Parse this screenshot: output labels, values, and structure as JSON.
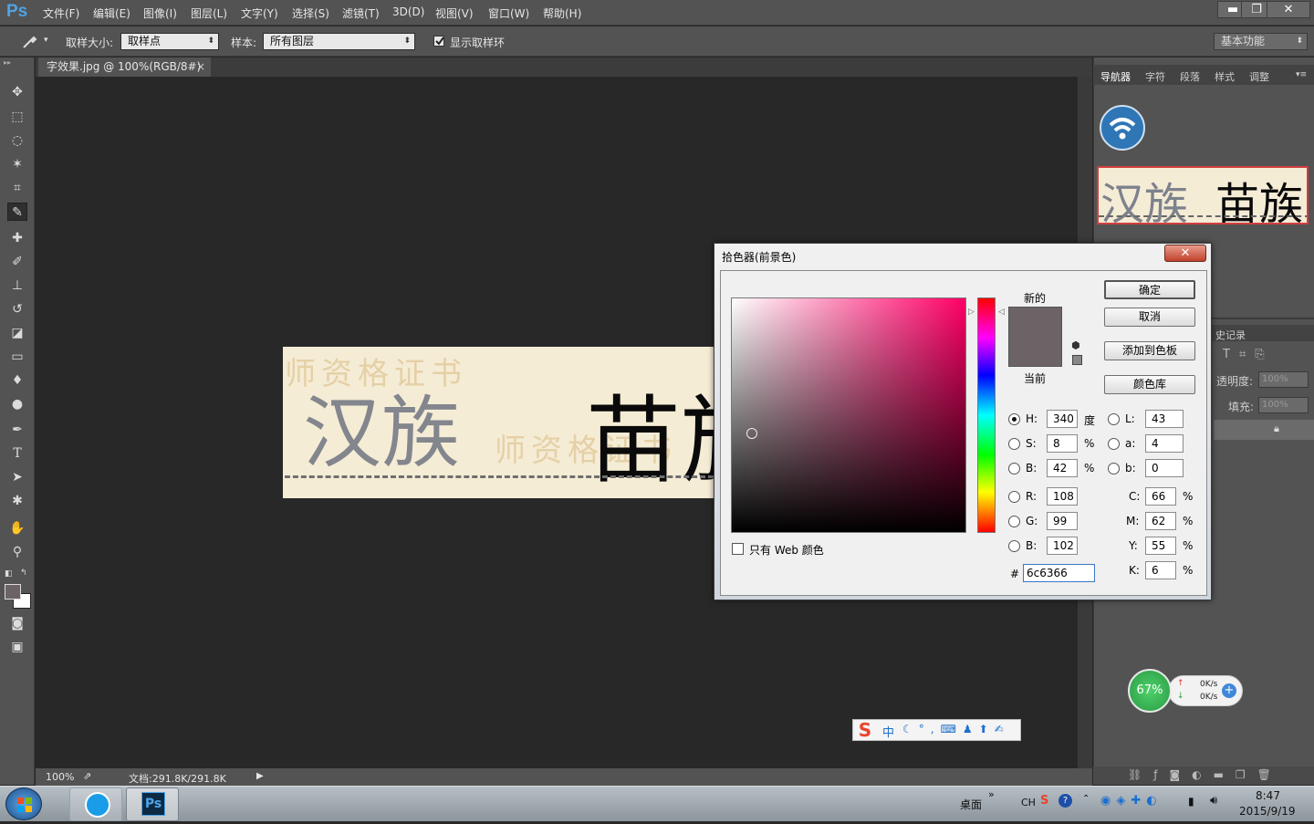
{
  "app": {
    "logo": "Ps"
  },
  "menu": [
    "文件(F)",
    "编辑(E)",
    "图像(I)",
    "图层(L)",
    "文字(Y)",
    "选择(S)",
    "滤镜(T)",
    "3D(D)",
    "视图(V)",
    "窗口(W)",
    "帮助(H)"
  ],
  "window_controls": {
    "minimize": "▬",
    "restore": "❐",
    "close": "✕"
  },
  "options": {
    "sample_size_label": "取样大小:",
    "sample_size_value": "取样点",
    "sample_label": "样本:",
    "sample_value": "所有图层",
    "show_ring_label": "显示取样环",
    "workspace": "基本功能"
  },
  "document": {
    "tab": "字效果.jpg @ 100%(RGB/8#)",
    "tab_close": "×",
    "zoom": "100%",
    "doc_size": "文档:291.8K/291.8K"
  },
  "image": {
    "text_left": "汉族",
    "text_right": "苗族",
    "watermark": "师资格证书"
  },
  "panel_tabs": [
    "导航器",
    "字符",
    "段落",
    "样式",
    "调整"
  ],
  "layers_panel": {
    "history_tab": "史记录",
    "opacity_label": "透明度:",
    "opacity_value": "100%",
    "fill_label": "填充:",
    "fill_value": "100%"
  },
  "color_picker": {
    "title": "拾色器(前景色)",
    "close": "✕",
    "new_label": "新的",
    "current_label": "当前",
    "buttons": {
      "ok": "确定",
      "cancel": "取消",
      "add_swatch": "添加到色板",
      "libraries": "颜色库"
    },
    "web_only_label": "只有 Web 颜色",
    "hsb": {
      "h_label": "H:",
      "h": "340",
      "h_unit": "度",
      "s_label": "S:",
      "s": "8",
      "s_unit": "%",
      "b_label": "B:",
      "b": "42",
      "b_unit": "%"
    },
    "rgb": {
      "r_label": "R:",
      "r": "108",
      "g_label": "G:",
      "g": "99",
      "b_label": "B:",
      "b": "102"
    },
    "lab": {
      "l_label": "L:",
      "l": "43",
      "a_label": "a:",
      "a": "4",
      "b_label": "b:",
      "b": "0"
    },
    "cmyk": {
      "c_label": "C:",
      "c": "66",
      "m_label": "M:",
      "m": "62",
      "y_label": "Y:",
      "y": "55",
      "k_label": "K:",
      "k": "6",
      "unit": "%"
    },
    "hex_label": "#",
    "hex": "6c6366",
    "new_color": "#6c6366",
    "hue_color": "#ff0066"
  },
  "net_widget": {
    "percent": "67%",
    "up": "0K/s",
    "down": "0K/s"
  },
  "ime": {
    "mode": "中"
  },
  "taskbar": {
    "desktop": "桌面",
    "lang": "CH",
    "time": "8:47",
    "date": "2015/9/19"
  }
}
